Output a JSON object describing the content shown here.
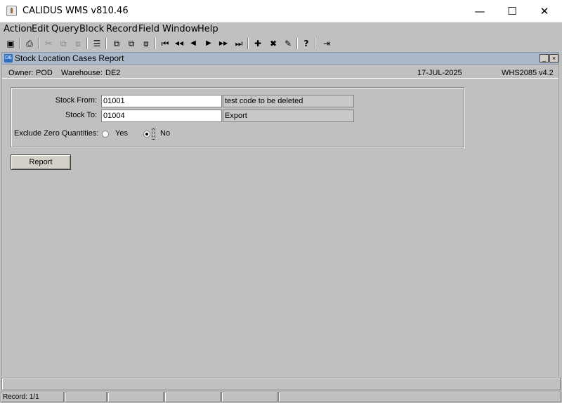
{
  "window": {
    "title": "CALIDUS WMS v810.46",
    "minimize_glyph": "—",
    "maximize_glyph": "☐",
    "close_glyph": "✕"
  },
  "menu": [
    "Action",
    "Edit",
    "Query",
    "Block",
    "Record",
    "Field",
    "Window",
    "Help"
  ],
  "toolbar": {
    "icons": [
      "save-icon",
      "print-icon",
      "cut-icon",
      "copy-icon",
      "paste-icon",
      "clear-icon",
      "query-enter-icon",
      "query-execute-icon",
      "query-cancel-icon",
      "first-record-icon",
      "prev-block-icon",
      "prev-record-icon",
      "next-record-icon",
      "next-block-icon",
      "last-record-icon",
      "insert-record-icon",
      "delete-record-icon",
      "edit-field-icon",
      "help-icon",
      "exit-icon"
    ],
    "glyphs": {
      "save": "▣",
      "print": "⎙",
      "cut": "✂",
      "copy": "⧉",
      "paste": "⧈",
      "clear": "☰",
      "q1": "⧉",
      "q2": "⧉",
      "q3": "⧈",
      "first": "⏮",
      "prevblock": "◀◀",
      "prev": "◀",
      "next": "▶",
      "nextblock": "▶▶",
      "last": "⏭",
      "insert": "✚",
      "delete": "✖",
      "edit": "✎",
      "help": "?",
      "exit": "⇥"
    }
  },
  "form": {
    "title": "Stock Location Cases Report",
    "icon_text": "DB",
    "min_glyph": "_",
    "close_glyph": "×",
    "owner_label": "Owner:",
    "owner_value": "POD",
    "warehouse_label": "Warehouse:",
    "warehouse_value": "DE2",
    "date": "17-JUL-2025",
    "form_code": "WHS2085",
    "version": "v4.2"
  },
  "fields": {
    "stock_from_label": "Stock From:",
    "stock_from_value": "01001",
    "stock_from_desc": "test code to be deleted",
    "stock_to_label": "Stock To:",
    "stock_to_value": "01004",
    "stock_to_desc": "Export",
    "exclude_label": "Exclude Zero Quantities:",
    "yes_label": "Yes",
    "no_label": "No",
    "selected": "No"
  },
  "buttons": {
    "report": "Report"
  },
  "status": {
    "hint": "",
    "record": "Record: 1/1"
  },
  "colors": {
    "form_title_bg": "#aab8c9",
    "background": "#c0c0c0"
  }
}
